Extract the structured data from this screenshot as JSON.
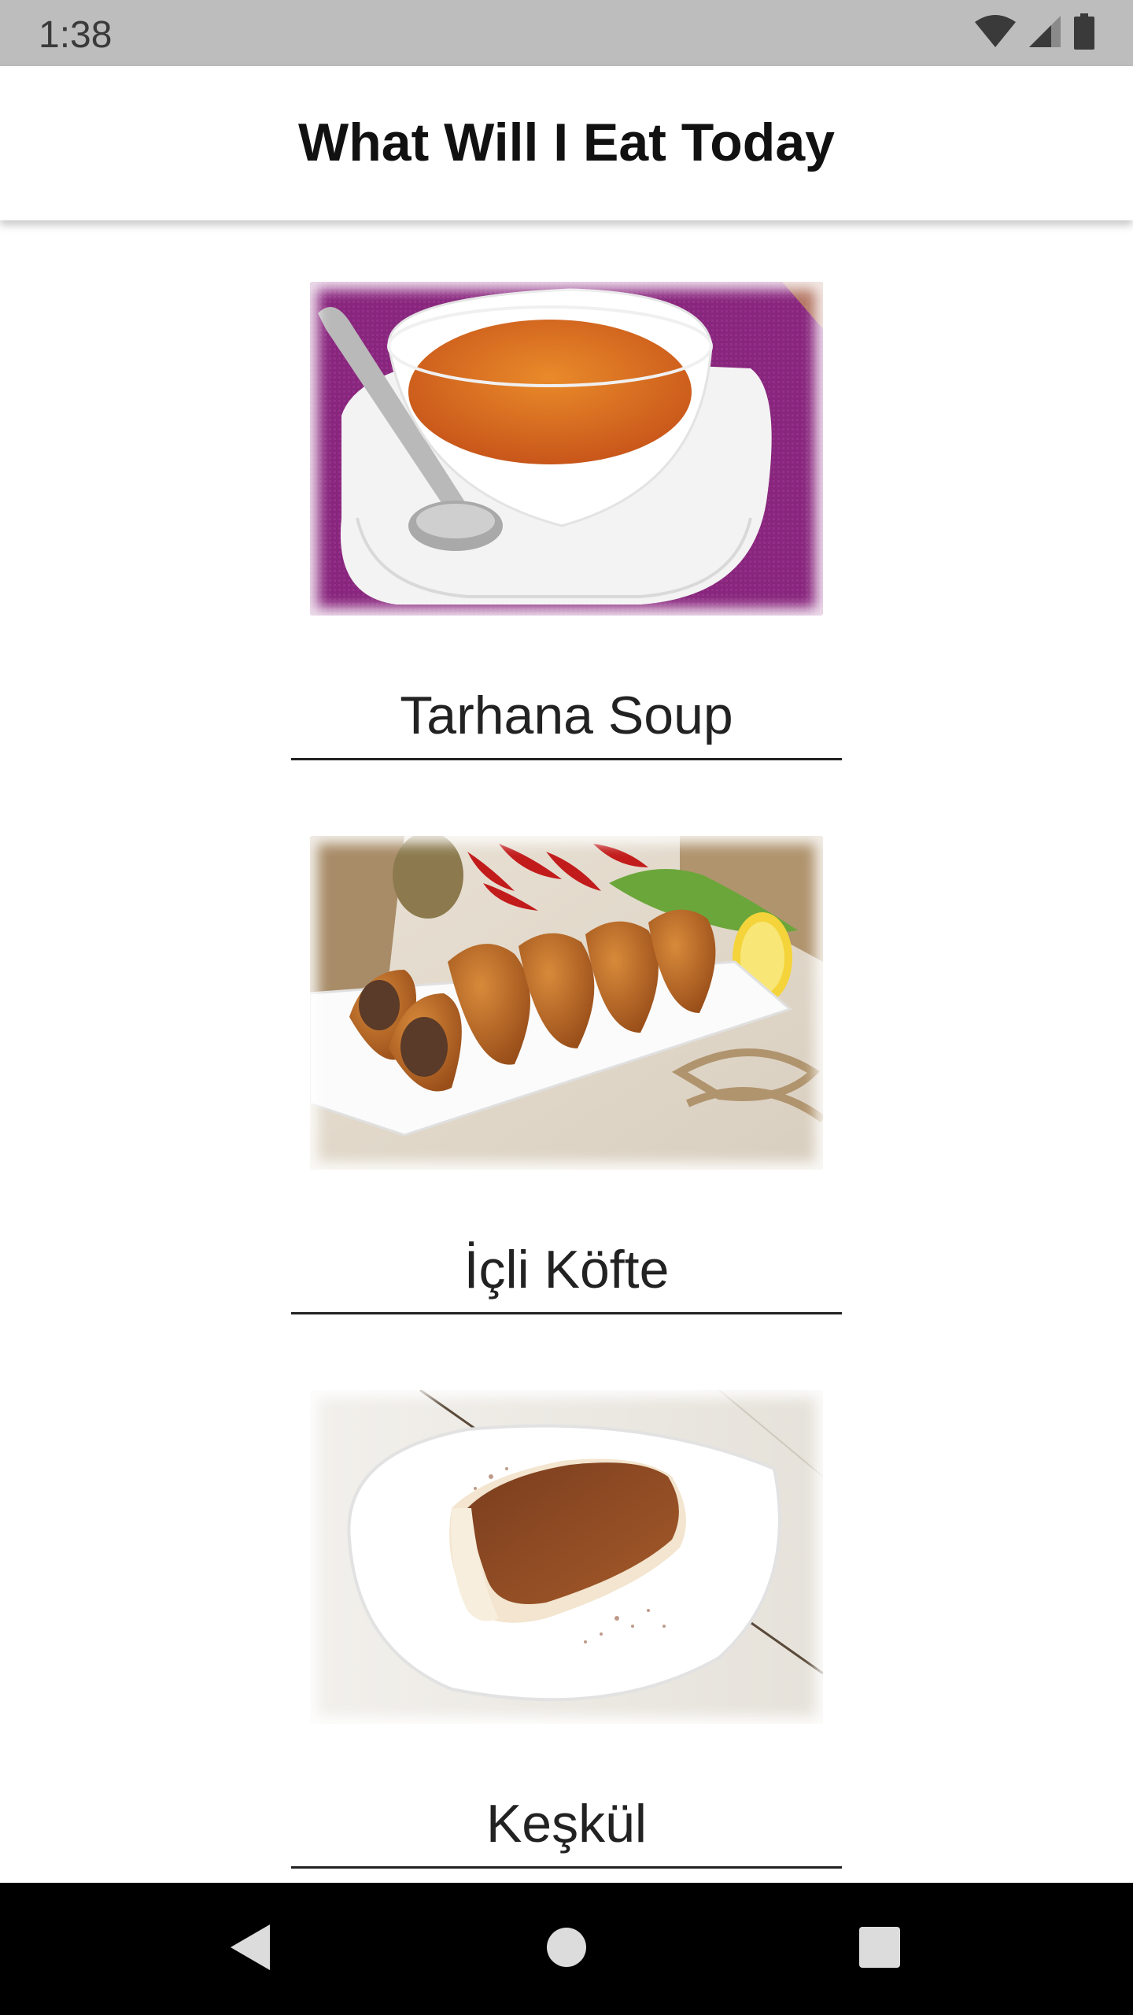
{
  "status_bar": {
    "time": "1:38",
    "icons": [
      "wifi-icon",
      "cell-signal-icon",
      "battery-icon"
    ]
  },
  "app_bar": {
    "title": "What Will I Eat Today"
  },
  "foods": [
    {
      "name": "Tarhana Soup",
      "image": "tarhana-soup-image"
    },
    {
      "name": "İçli Köfte",
      "image": "icli-kofte-image"
    },
    {
      "name": "Keşkül",
      "image": "keskul-image"
    }
  ],
  "nav_bar": {
    "icons": [
      "back-icon",
      "home-icon",
      "recents-icon"
    ]
  }
}
